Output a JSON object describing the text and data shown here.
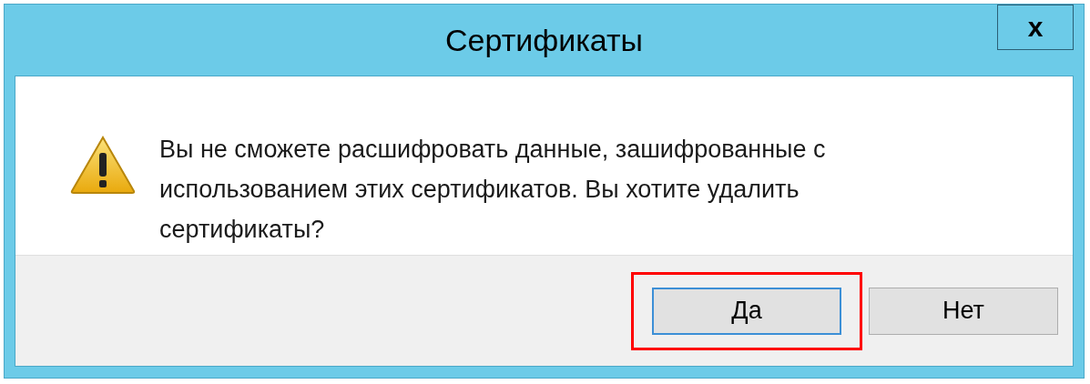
{
  "window": {
    "title": "Сертификаты",
    "close": "x"
  },
  "message": "Вы не сможете расшифровать данные, зашифрованные с использованием этих сертификатов. Вы хотите удалить сертификаты?",
  "buttons": [
    {
      "label": "Да",
      "focused": true,
      "highlighted": true
    },
    {
      "label": "Нет",
      "focused": false,
      "highlighted": false
    }
  ]
}
